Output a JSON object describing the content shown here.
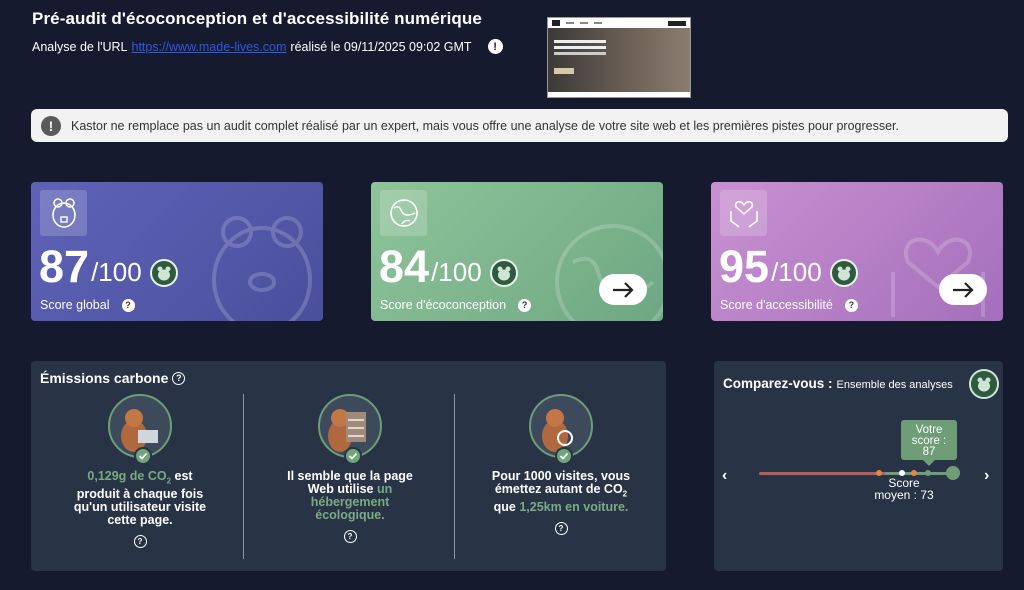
{
  "header": {
    "title": "Pré-audit d'écoconception et d'accessibilité numérique",
    "url_prefix": "Analyse de l'URL",
    "url": "https://www.made-lives.com",
    "date_text": "réalisé le 09/11/2025 09:02 GMT"
  },
  "notice": {
    "text": "Kastor ne remplace pas un audit complet réalisé par un expert, mais vous offre une analyse de votre site web et les premières pistes pour progresser."
  },
  "scores": {
    "global": {
      "value": "87",
      "max": "/100",
      "label": "Score global",
      "color": "#5a5fb0"
    },
    "eco": {
      "value": "84",
      "max": "/100",
      "label": "Score d'écoconception",
      "color": "#7fb68b"
    },
    "access": {
      "value": "95",
      "max": "/100",
      "label": "Score d'accessibilité",
      "color": "#b880c8"
    }
  },
  "carbon": {
    "title": "Émissions carbone",
    "col1": {
      "highlight": "0,129g de CO",
      "sub": "2",
      "rest": " est produit à chaque fois qu'un utilisateur visite cette page."
    },
    "col2": {
      "text": "Il semble que la page Web utilise ",
      "highlight": "un hébergement écologique."
    },
    "col3": {
      "text": "Pour 1000 visites, vous émettez autant de CO",
      "sub": "2",
      "text2": " que ",
      "highlight": "1,25km en voiture."
    }
  },
  "compare": {
    "title": "Comparez-vous :",
    "subtitle": "Ensemble des analyses",
    "your_score_label": "Votre score :",
    "your_score": "87",
    "avg_label": "Score moyen : 73",
    "your_score_fraction": 0.87,
    "avg_fraction": 0.73
  },
  "icons": {
    "info": "info-icon",
    "arrow": "arrow-right-icon",
    "prev": "chevron-left-icon",
    "next": "chevron-right-icon"
  }
}
